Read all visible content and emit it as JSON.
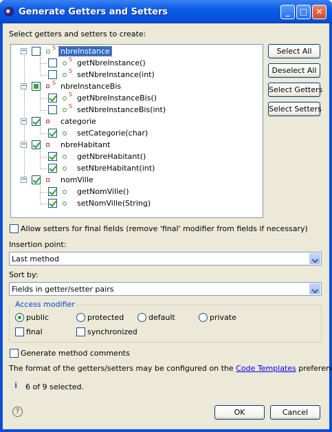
{
  "window": {
    "title": "Generate Getters and Setters"
  },
  "instructions": "Select getters and setters to create:",
  "tree": [
    {
      "label": "nbreInstance",
      "checked": "off",
      "selected": true,
      "static": true
    },
    {
      "label": "getNbreInstance()",
      "checked": "off",
      "static": true
    },
    {
      "label": "setNbreInstance(int)",
      "checked": "off",
      "static": true
    },
    {
      "label": "nbreInstanceBis",
      "checked": "partial",
      "static": true
    },
    {
      "label": "getNbreInstanceBis()",
      "checked": "on",
      "static": true
    },
    {
      "label": "setNbreInstanceBis(int)",
      "checked": "off",
      "static": true
    },
    {
      "label": "categorie",
      "checked": "on"
    },
    {
      "label": "setCategorie(char)",
      "checked": "on"
    },
    {
      "label": "nbreHabitant",
      "checked": "on"
    },
    {
      "label": "getNbreHabitant()",
      "checked": "on"
    },
    {
      "label": "setNbreHabitant(int)",
      "checked": "on"
    },
    {
      "label": "nomVille",
      "checked": "on"
    },
    {
      "label": "getNomVille()",
      "checked": "on"
    },
    {
      "label": "setNomVille(String)",
      "checked": "on"
    }
  ],
  "buttons": {
    "select_all": "Select All",
    "deselect_all": "Deselect All",
    "select_getters": "Select Getters",
    "select_setters": "Select Setters",
    "ok": "OK",
    "cancel": "Cancel"
  },
  "allow_setters_final": "Allow setters for final fields (remove 'final' modifier from fields if necessary)",
  "insertion_point": {
    "label": "Insertion point:",
    "value": "Last method"
  },
  "sort_by": {
    "label": "Sort by:",
    "value": "Fields in getter/setter pairs"
  },
  "access_modifier": {
    "title": "Access modifier",
    "options": [
      "public",
      "protected",
      "default",
      "private"
    ],
    "selected": "public",
    "final_label": "final",
    "synchronized_label": "synchronized"
  },
  "generate_comments": "Generate method comments",
  "footer": {
    "text_before": "The format of the getters/setters may be configured on the",
    "link": "Code Templates",
    "text_after": "preference page."
  },
  "status": {
    "icon": "info-icon",
    "text": "6 of 9 selected."
  },
  "colors": {
    "titlebar": "#0a5be5",
    "selection": "#316ac5",
    "dialog_bg": "#ece9d8"
  }
}
